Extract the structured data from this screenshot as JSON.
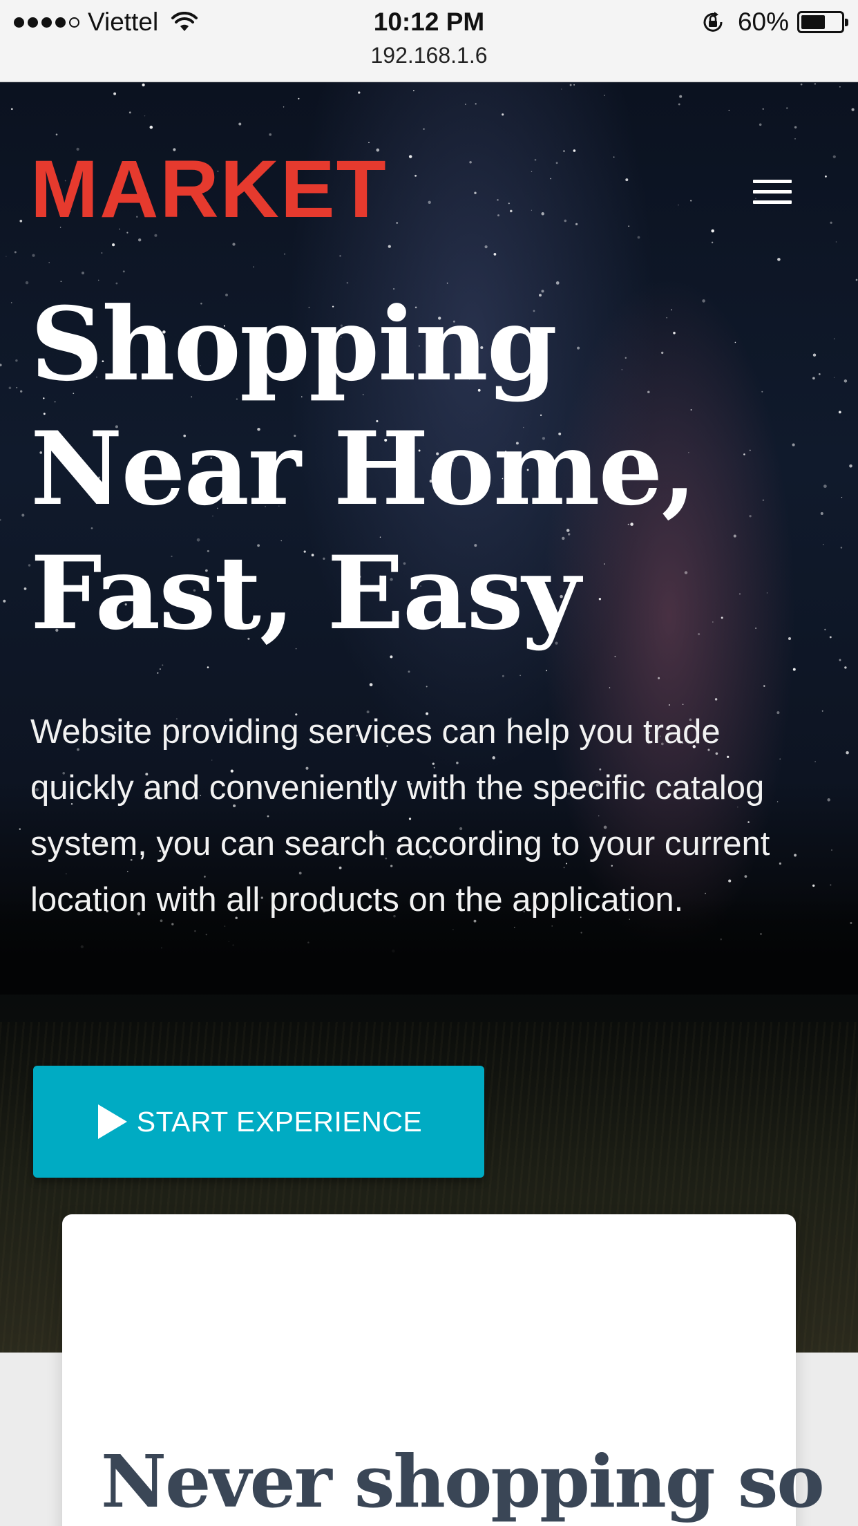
{
  "status_bar": {
    "carrier": "Viettel",
    "time": "10:12 PM",
    "battery_percent": "60%",
    "battery_level": 0.6,
    "url": "192.168.1.6",
    "signal_bars_filled": 4,
    "signal_bars_total": 5
  },
  "header": {
    "logo_text": "MARKET",
    "logo_color": "#e63a2e",
    "menu_icon": "hamburger-icon"
  },
  "hero": {
    "headline": "Shopping Near Home, Fast, Easy",
    "description": "Website providing services can help you trade quickly and conveniently with the specific catalog system, you can search according to your current location with all products on the application.",
    "cta_label": "START EXPERIENCE",
    "cta_icon": "play-icon",
    "cta_color": "#00abc3"
  },
  "card": {
    "title": "Never shopping so"
  }
}
